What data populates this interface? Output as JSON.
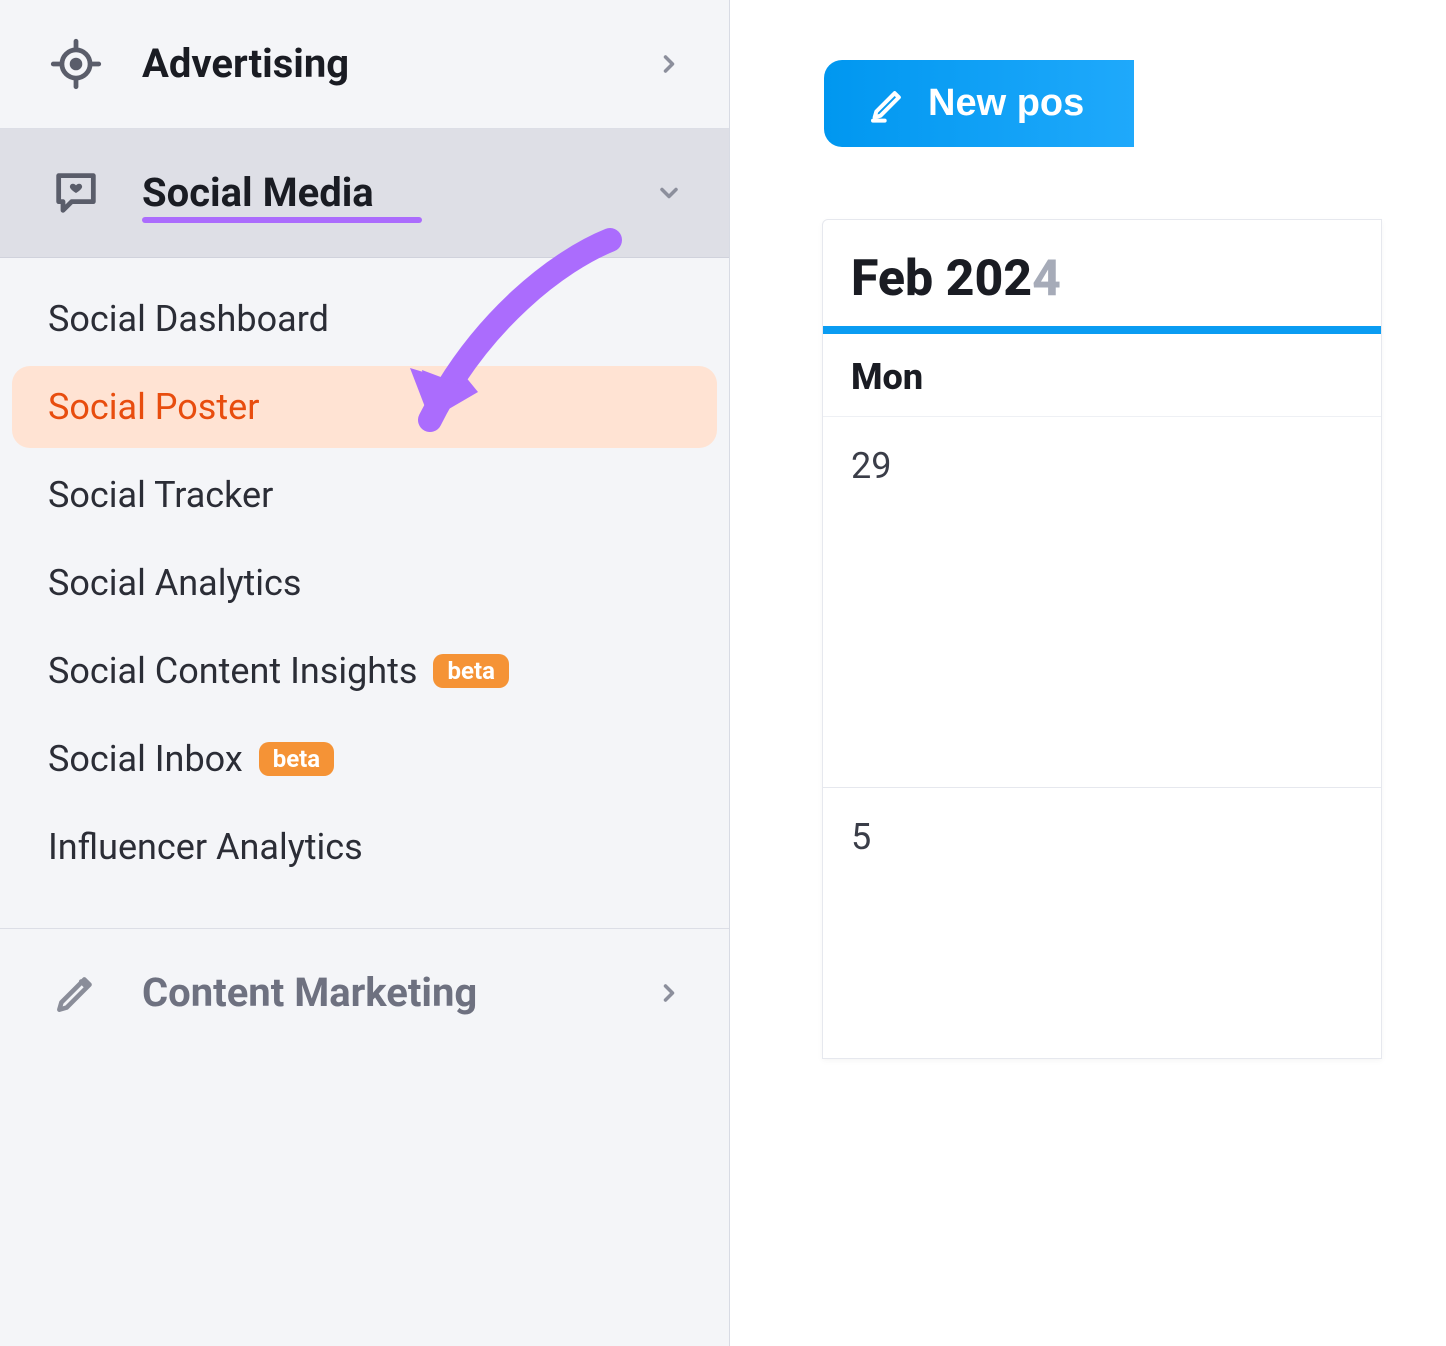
{
  "sidebar": {
    "sections": {
      "advertising": {
        "label": "Advertising"
      },
      "social_media": {
        "label": "Social Media"
      },
      "content_marketing": {
        "label": "Content Marketing"
      }
    },
    "submenu": [
      {
        "label": "Social Dashboard",
        "beta": ""
      },
      {
        "label": "Social Poster",
        "beta": ""
      },
      {
        "label": "Social Tracker",
        "beta": ""
      },
      {
        "label": "Social Analytics",
        "beta": ""
      },
      {
        "label": "Social Content Insights",
        "beta": "beta"
      },
      {
        "label": "Social Inbox",
        "beta": "beta"
      },
      {
        "label": "Influencer Analytics",
        "beta": ""
      }
    ]
  },
  "main": {
    "new_post_label": "New pos",
    "calendar": {
      "month_prefix": "Feb 202",
      "month_suffix": "4",
      "day_header": "Mon",
      "cells": [
        "29",
        "5"
      ]
    }
  },
  "colors": {
    "accent_blue": "#0a9cf2",
    "highlight_orange": "#e84d0e",
    "highlight_bg": "#ffe3d3",
    "annotation_purple": "#ab6cfd",
    "beta_orange": "#f59336"
  }
}
